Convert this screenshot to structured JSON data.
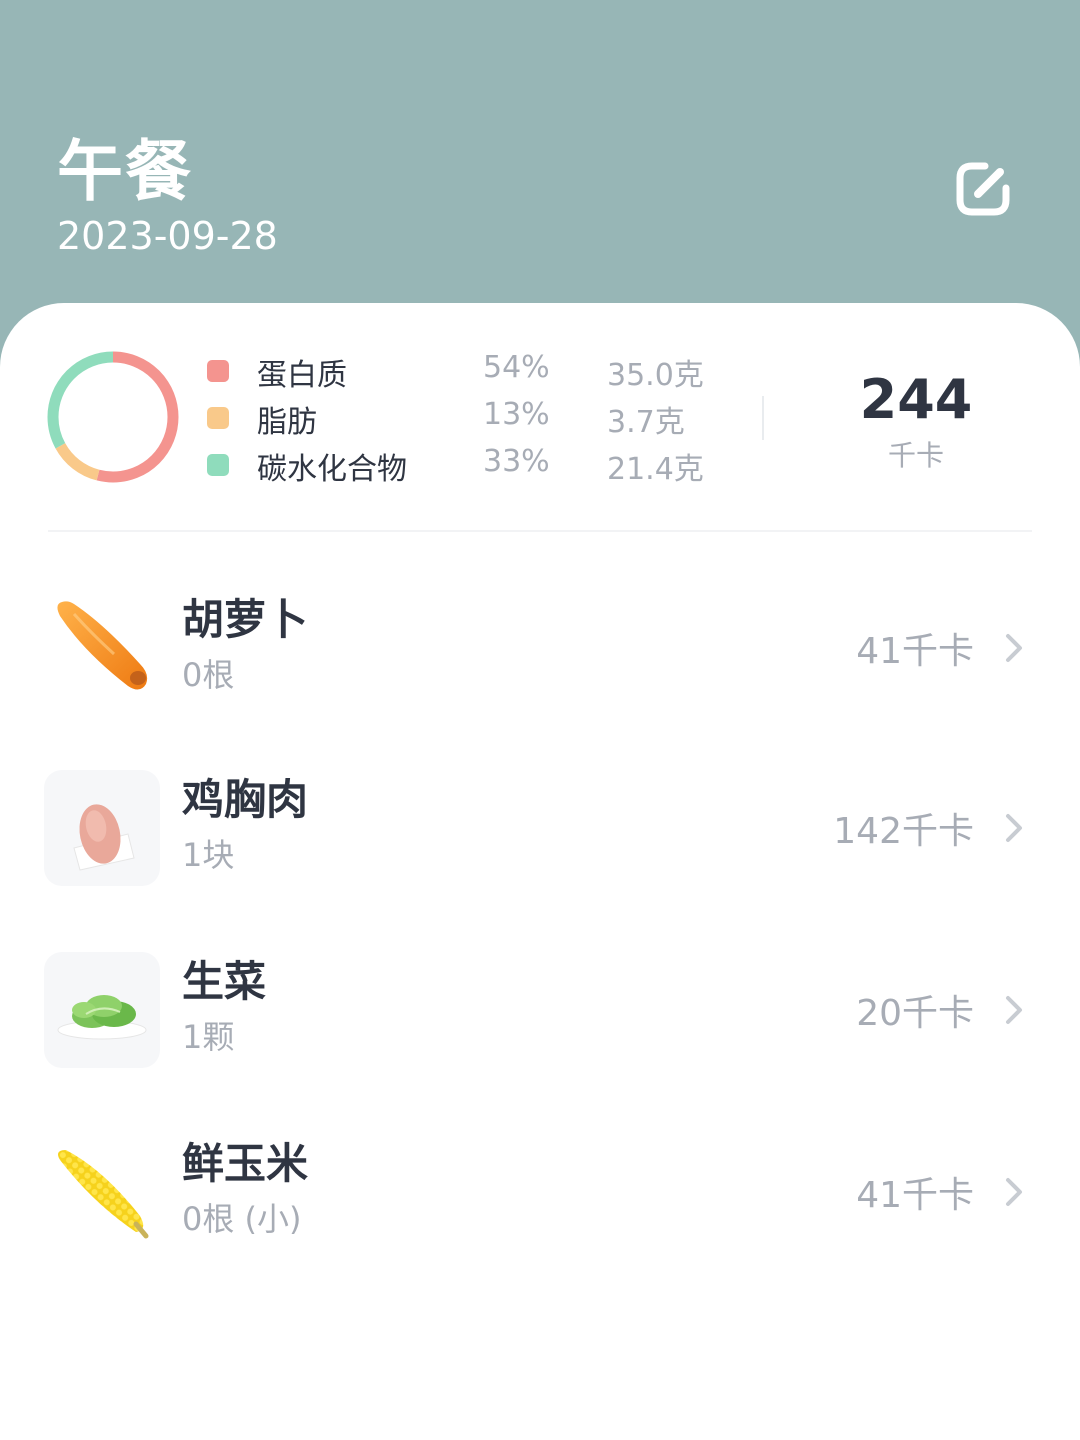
{
  "header": {
    "title": "午餐",
    "date": "2023-09-28",
    "edit_icon": "edit-square-icon"
  },
  "summary": {
    "macros": [
      {
        "name": "蛋白质",
        "percent": "54%",
        "grams": "35.0克",
        "color": "#f4948f",
        "share": 0.54
      },
      {
        "name": "脂肪",
        "percent": "13%",
        "grams": "3.7克",
        "color": "#f9c98a",
        "share": 0.13
      },
      {
        "name": "碳水化合物",
        "percent": "33%",
        "grams": "21.4克",
        "color": "#8fdcbc",
        "share": 0.33
      }
    ],
    "total_kcal": "244",
    "kcal_unit": "千卡"
  },
  "foods": [
    {
      "name": "胡萝卜",
      "amount": "0根",
      "kcal": "41千卡",
      "icon": "carrot-icon"
    },
    {
      "name": "鸡胸肉",
      "amount": "1块",
      "kcal": "142千卡",
      "icon": "chicken-breast-icon"
    },
    {
      "name": "生菜",
      "amount": "1颗",
      "kcal": "20千卡",
      "icon": "lettuce-icon"
    },
    {
      "name": "鲜玉米",
      "amount": "0根 (小)",
      "kcal": "41千卡",
      "icon": "corn-icon"
    }
  ],
  "colors": {
    "header_bg": "#97b6b6",
    "text_primary": "#2f3542",
    "text_secondary": "#a7acb5"
  }
}
